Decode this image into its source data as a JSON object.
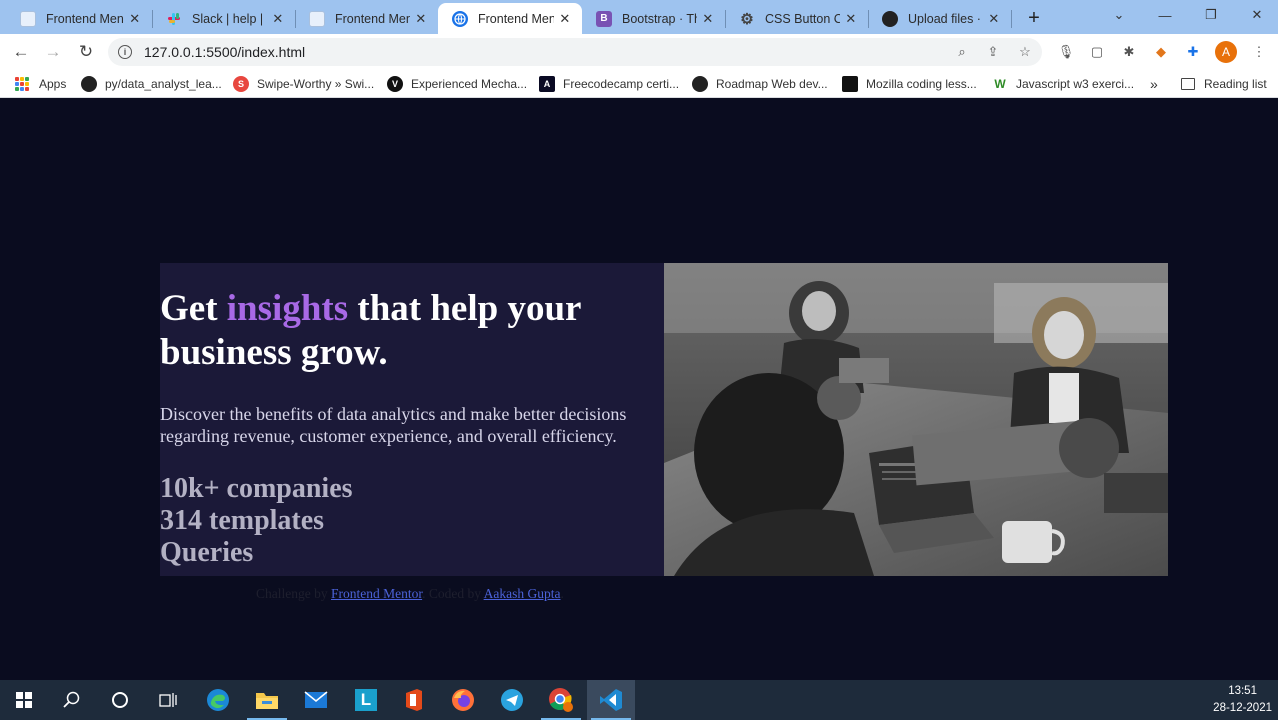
{
  "browser": {
    "tabs": [
      {
        "title": "Frontend Ment",
        "favicon": "frontend-mentor-icon",
        "active": false
      },
      {
        "title": "Slack | help | Fr",
        "favicon": "slack-icon",
        "active": false
      },
      {
        "title": "Frontend Ment",
        "favicon": "frontend-mentor-icon",
        "active": false
      },
      {
        "title": "Frontend Ment",
        "favicon": "globe-icon",
        "active": true
      },
      {
        "title": "Bootstrap · The",
        "favicon": "bootstrap-icon",
        "active": false
      },
      {
        "title": "CSS Button Cre",
        "favicon": "gear-icon",
        "active": false
      },
      {
        "title": "Upload files · A",
        "favicon": "github-icon",
        "active": false
      }
    ],
    "url": "127.0.0.1:5500/index.html",
    "profile_initial": "A",
    "bookmarks": [
      {
        "label": "Apps",
        "icon": "apps-grid-icon"
      },
      {
        "label": "py/data_analyst_lea...",
        "icon": "github-icon"
      },
      {
        "label": "Swipe-Worthy » Swi...",
        "icon": "swipe-icon"
      },
      {
        "label": "Experienced Mecha...",
        "icon": "v-icon"
      },
      {
        "label": "Freecodecamp certi...",
        "icon": "freecodecamp-icon"
      },
      {
        "label": "Roadmap Web dev...",
        "icon": "github-icon"
      },
      {
        "label": "Mozilla coding less...",
        "icon": "mozilla-icon"
      },
      {
        "label": "Javascript w3 exerci...",
        "icon": "w3-icon"
      }
    ],
    "overflow_label": "»",
    "reading_list_label": "Reading list"
  },
  "page": {
    "headline_before": "Get ",
    "headline_accent": "insights",
    "headline_after": " that help your business grow.",
    "description": "Discover the benefits of data analytics and make better decisions regarding revenue, customer experience, and overall efficiency.",
    "stats": [
      "10k+ companies",
      "314 templates",
      "Queries"
    ],
    "attribution": {
      "prefix": "Challenge by ",
      "link1": "Frontend Mentor",
      "middle": ". Coded by ",
      "link2": "Aakash Gupta",
      "suffix": "."
    }
  },
  "taskbar": {
    "apps": [
      "windows-start-icon",
      "search-icon",
      "cortana-icon",
      "task-view-icon",
      "edge-icon",
      "file-explorer-icon",
      "mail-icon",
      "l-app-icon",
      "office-icon",
      "firefox-icon",
      "telegram-icon",
      "chrome-icon",
      "vscode-icon"
    ],
    "time": "13:51",
    "date": "28-12-2021"
  },
  "colors": {
    "page_bg": "#0a0c1f",
    "card_bg": "#1b1938",
    "accent": "#a869e6",
    "link": "#4b62d8"
  }
}
